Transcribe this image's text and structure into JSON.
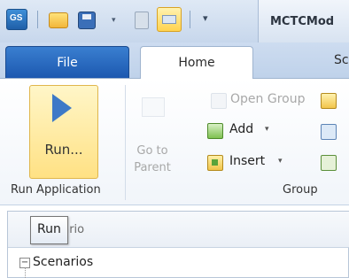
{
  "qat": {
    "customize_glyph": "▾",
    "dropdown_glyph": "▾",
    "title": "MCTCMod"
  },
  "tabs": {
    "file": "File",
    "home": "Home",
    "next_partial": "Sc"
  },
  "ribbon": {
    "run_label": "Run...",
    "run_group": "Run Application",
    "goto_parent": "Go to Parent",
    "open_group": "Open Group",
    "add": "Add",
    "insert": "Insert",
    "dropdown_glyph": "▾",
    "group_label": "Group"
  },
  "pane": {
    "header_partial": "enario",
    "tooltip": "Run",
    "tree_toggle": "−",
    "tree_root": "Scenarios"
  }
}
